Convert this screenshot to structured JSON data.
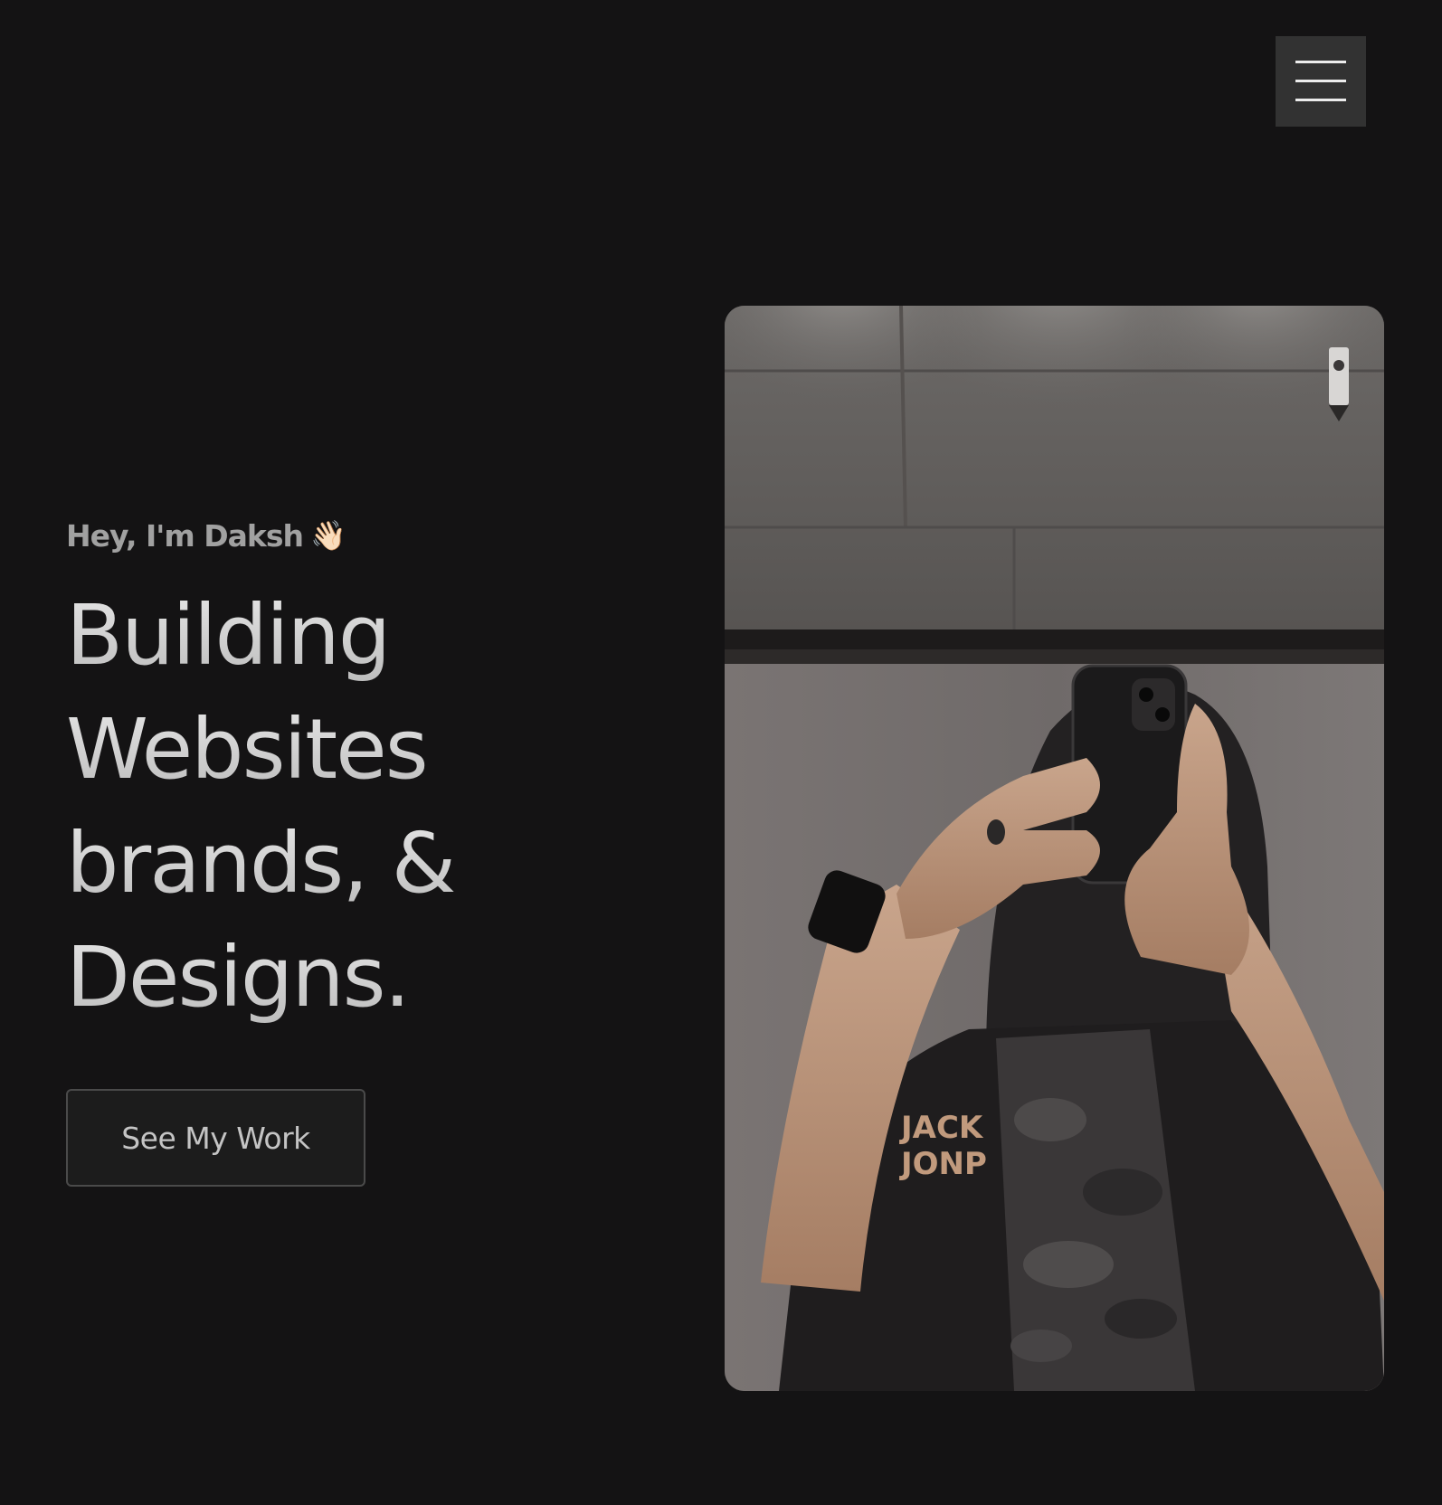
{
  "header": {
    "menu_icon": "hamburger-menu-icon"
  },
  "hero": {
    "greeting": "Hey, I'm Daksh",
    "wave_emoji": "👋🏻",
    "headline_lines": [
      "Building",
      "Websites",
      "brands, &",
      "Designs."
    ],
    "cta_label": "See My Work"
  },
  "photo": {
    "shirt_print_top": "JACK",
    "shirt_print_bottom": "JONP"
  },
  "colors": {
    "background": "#141314",
    "menu_button": "#323232",
    "greeting_text": "#a1a1a1",
    "headline_text": "#d8d8d8",
    "button_border": "#4a4a4a"
  }
}
